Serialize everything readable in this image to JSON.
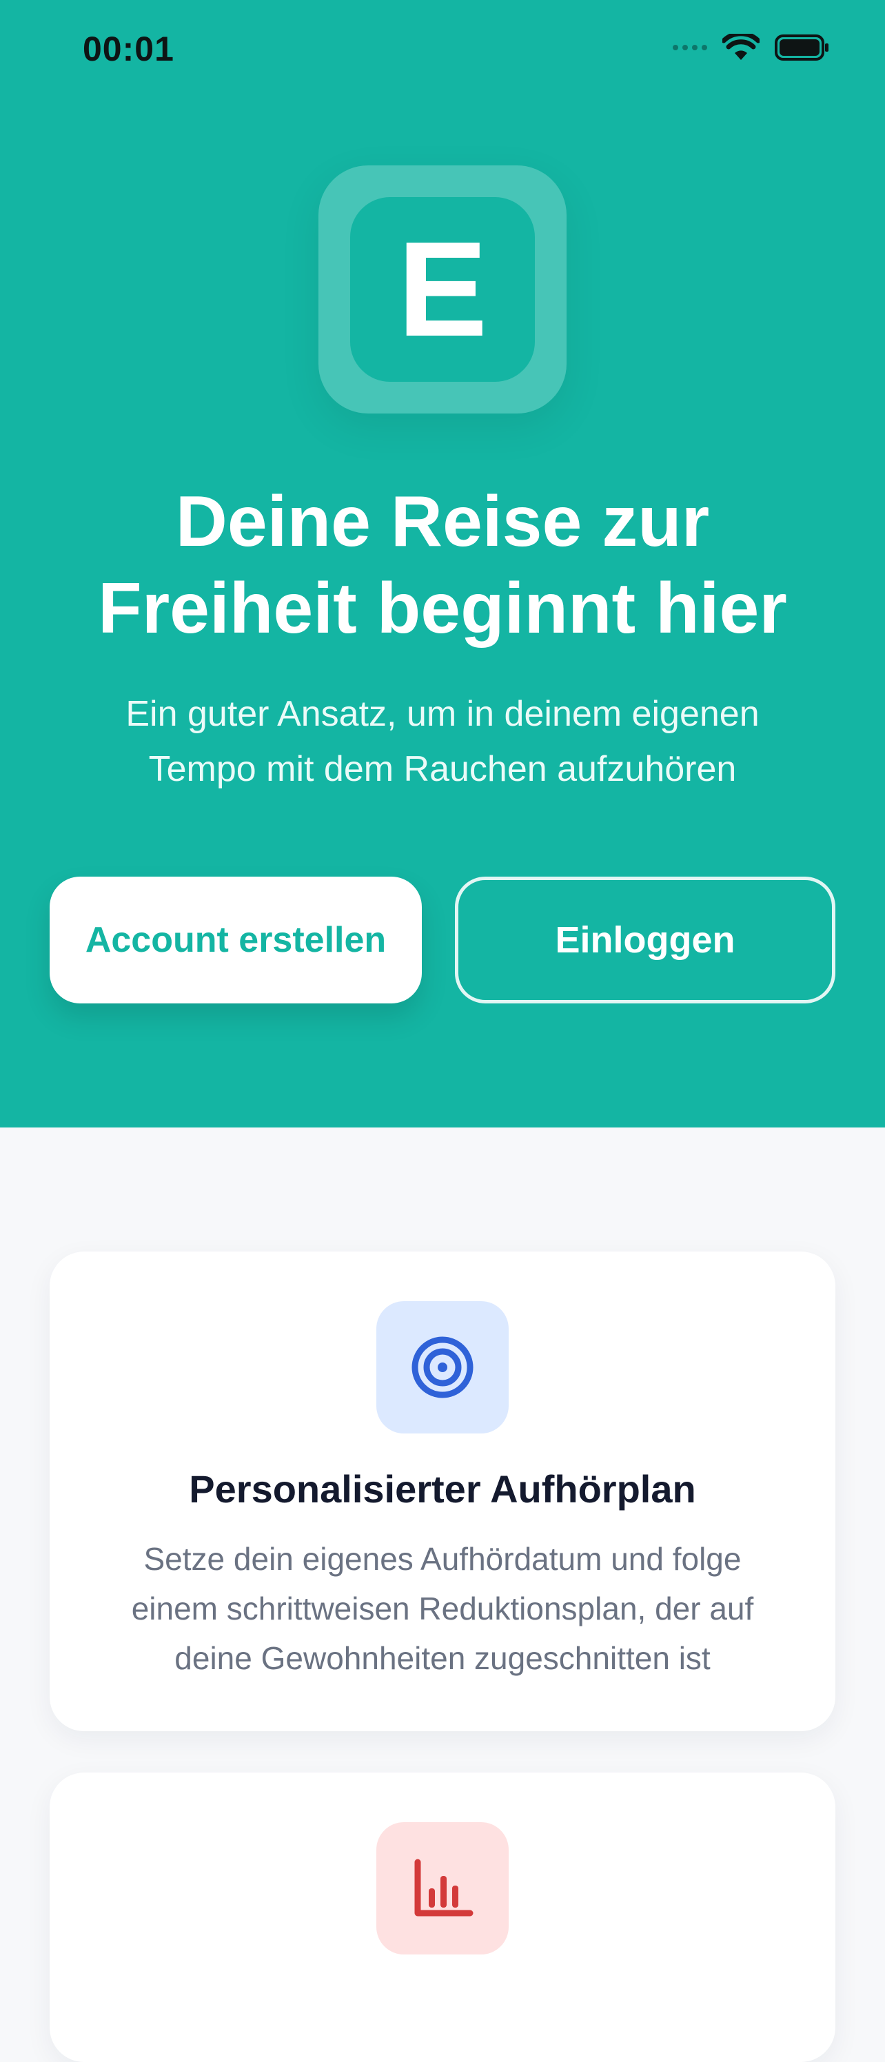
{
  "status_bar": {
    "time": "00:01",
    "icons": [
      "signal-icon",
      "wifi-icon",
      "battery-icon"
    ]
  },
  "hero": {
    "logo_letter": "E",
    "title_line1": "Deine Reise zur",
    "title_line2": "Freiheit beginnt hier",
    "subtitle_line1": "Ein guter Ansatz, um in deinem eigenen",
    "subtitle_line2": "Tempo mit dem Rauchen aufzuhören",
    "create_account_label": "Account erstellen",
    "login_label": "Einloggen"
  },
  "features": [
    {
      "icon": "target-icon",
      "title": "Personalisierter Aufhörplan",
      "text_line1": "Setze dein eigenes Aufhördatum und folge",
      "text_line2": "einem schrittweisen Reduktionsplan, der auf",
      "text_line3": "deine Gewohnheiten zugeschnitten ist"
    },
    {
      "icon": "bar-chart-icon",
      "title": "",
      "text_line1": "",
      "text_line2": "",
      "text_line3": ""
    }
  ],
  "colors": {
    "brand_teal": "#14B5A3",
    "background": "#F7F8FA",
    "card": "#FFFFFF",
    "blue_icon": "#2F62D8",
    "red_icon": "#D33A3A"
  }
}
